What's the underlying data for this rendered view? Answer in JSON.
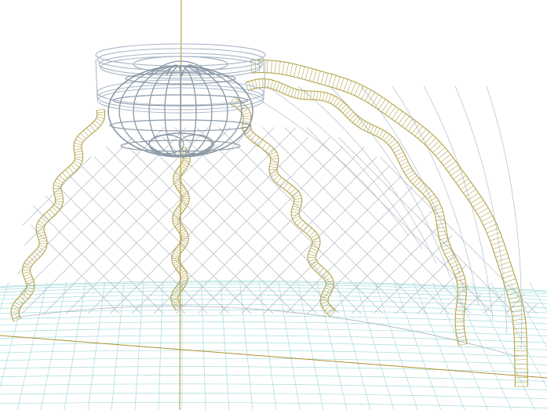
{
  "viewport": {
    "background": "#ffffff",
    "colors": {
      "grid_floor": "#a6dcdc",
      "axis": "#b0902c",
      "frame_gold": "#b3a34c",
      "frame_light": "#e4dca0",
      "canopy_net": "#a9b4bf",
      "ring_blue": "#a8b6c6",
      "cage_dark": "#8a98a6"
    },
    "scene_objects": [
      {
        "id": "floor-grid",
        "kind": "grid"
      },
      {
        "id": "world-axes",
        "kind": "axes"
      },
      {
        "id": "canopy-net",
        "kind": "mesh"
      },
      {
        "id": "leg-left",
        "kind": "wavy-leg"
      },
      {
        "id": "leg-center",
        "kind": "wavy-leg"
      },
      {
        "id": "leg-right",
        "kind": "wavy-leg"
      },
      {
        "id": "inner-arch",
        "kind": "ribbon-arch"
      },
      {
        "id": "outer-arch",
        "kind": "ribbon-arch"
      },
      {
        "id": "top-ring",
        "kind": "cylinder"
      },
      {
        "id": "spherical-cage",
        "kind": "sphere"
      }
    ]
  }
}
